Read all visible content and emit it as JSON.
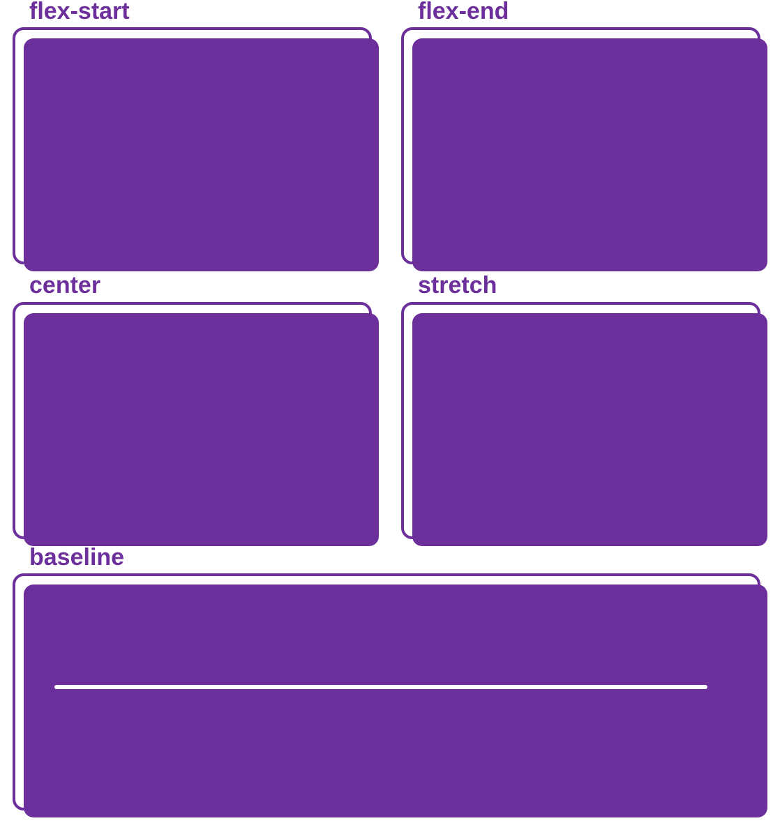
{
  "items": {
    "flex_start": {
      "label": "flex-start"
    },
    "flex_end": {
      "label": "flex-end"
    },
    "center": {
      "label": "center"
    },
    "stretch": {
      "label": "stretch"
    },
    "baseline": {
      "label": "baseline"
    }
  },
  "colors": {
    "accent": "#6c2f9b",
    "baseline_line": "#ffffff"
  }
}
